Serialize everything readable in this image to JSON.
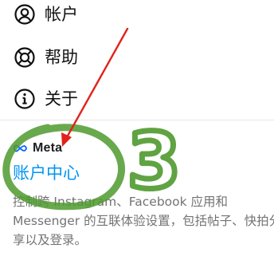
{
  "menu": {
    "items": [
      {
        "label": "帐户",
        "icon": "account-circle-icon"
      },
      {
        "label": "帮助",
        "icon": "help-lifebuoy-icon"
      },
      {
        "label": "关于",
        "icon": "info-icon"
      }
    ]
  },
  "meta_section": {
    "logo_text": "Meta",
    "accounts_center_label": "账户中心",
    "description": "控制跨 Instagram、Facebook 应用和 Messenger 的互联体验设置，包括帖子、快拍分享以及登录。"
  },
  "annotation": {
    "number": "3",
    "color": "#4f9a2e",
    "arrow_color": "#e0231b"
  },
  "colors": {
    "link": "#0095f6",
    "secondary_text": "#737373"
  }
}
